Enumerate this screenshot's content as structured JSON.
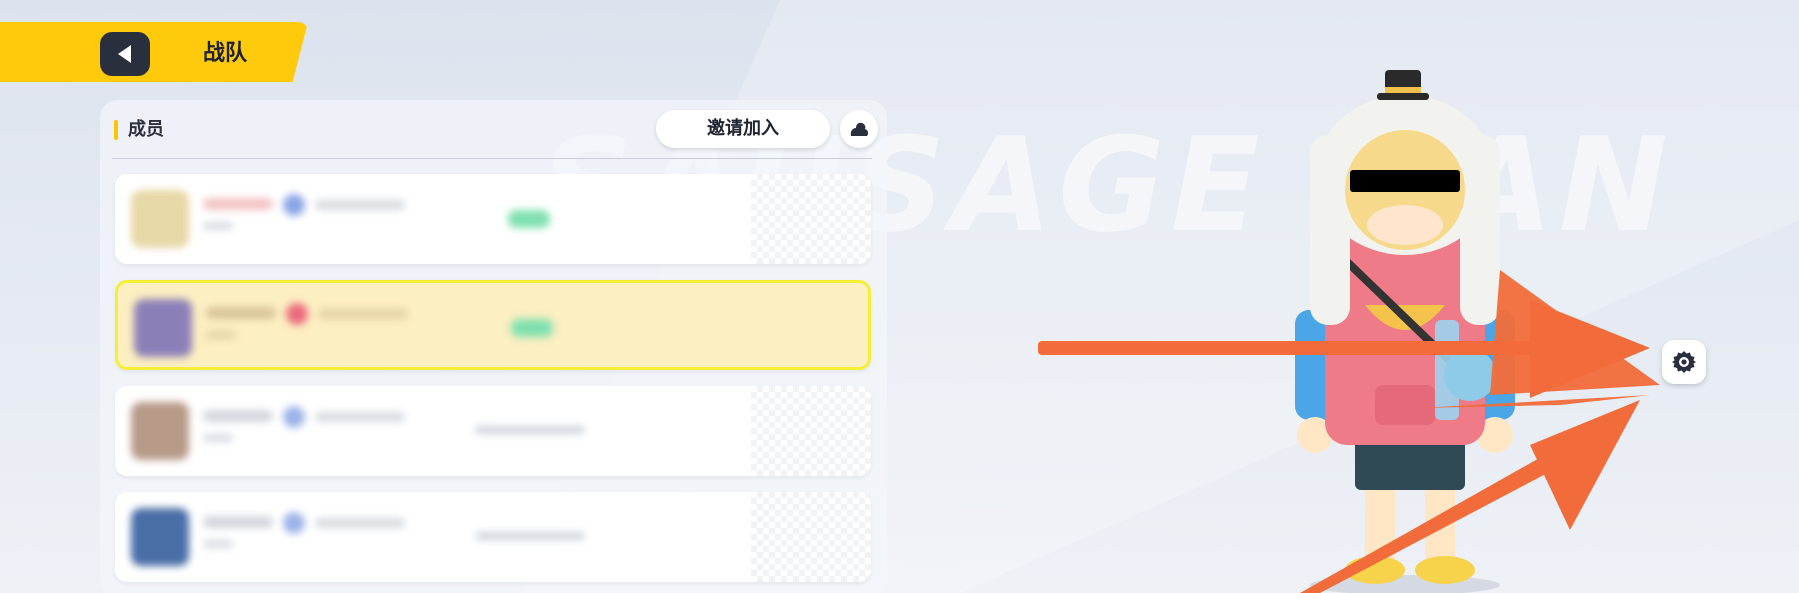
{
  "header": {
    "title": "战队",
    "back_icon": "back-arrow-icon",
    "accent_color": "#ffc90c"
  },
  "members_section": {
    "title": "成员",
    "invite_label": "邀请加入",
    "extra_icon": "team-icon",
    "rows": [
      {
        "state": "normal",
        "status": "green"
      },
      {
        "state": "highlighted",
        "status": "green"
      },
      {
        "state": "normal",
        "status": "gray"
      },
      {
        "state": "normal",
        "status": "gray"
      }
    ]
  },
  "background_watermark": "SAUSAGE MAN",
  "settings": {
    "icon": "gear-icon"
  },
  "annotation_arrows": {
    "color": "#f26b3a",
    "count": 3
  }
}
